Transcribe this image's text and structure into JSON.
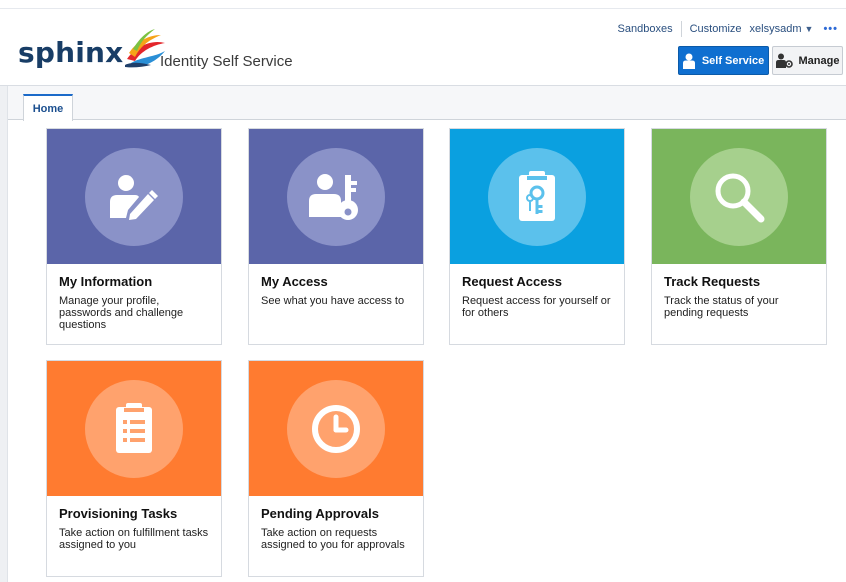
{
  "header": {
    "brand": "sphinx",
    "app_title": "Identity Self Service",
    "links": {
      "sandboxes": "Sandboxes",
      "customize": "Customize",
      "user": "xelsysadm",
      "more": "•••"
    },
    "buttons": {
      "self_service": "Self Service",
      "manage": "Manage"
    }
  },
  "tabs": [
    {
      "label": "Home",
      "active": true
    }
  ],
  "colors": {
    "purple": "#5b65a9",
    "blue": "#0aa0e0",
    "green": "#7ab55c",
    "orange": "#ff7b30",
    "primary_button": "#0f6fd0"
  },
  "tiles": [
    {
      "title": "My Information",
      "desc": "Manage your profile, passwords and challenge questions",
      "icon": "user-edit-icon",
      "color": "purple"
    },
    {
      "title": "My Access",
      "desc": "See what you have access to",
      "icon": "user-key-icon",
      "color": "purple"
    },
    {
      "title": "Request Access",
      "desc": "Request access for yourself or for others",
      "icon": "clipboard-key-icon",
      "color": "blue"
    },
    {
      "title": "Track Requests",
      "desc": "Track the status of your pending requests",
      "icon": "magnifier-icon",
      "color": "green"
    },
    {
      "title": "Provisioning Tasks",
      "desc": "Take action on fulfillment tasks assigned to you",
      "icon": "task-list-icon",
      "color": "orange"
    },
    {
      "title": "Pending Approvals",
      "desc": "Take action on requests assigned to you for approvals",
      "icon": "clock-icon",
      "color": "orange"
    }
  ]
}
